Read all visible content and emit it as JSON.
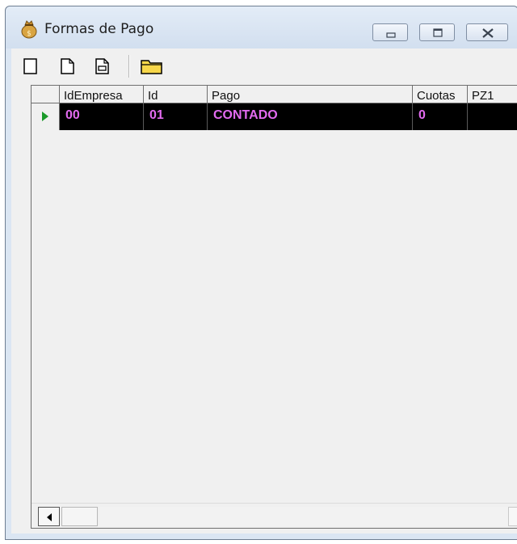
{
  "window": {
    "title": "Formas de Pago",
    "icon": "money-bag-icon"
  },
  "caption_buttons": {
    "minimize": "minimize-icon",
    "maximize": "maximize-icon",
    "close": "close-icon"
  },
  "toolbar": {
    "items": [
      "blank-page-icon",
      "new-document-icon",
      "edit-document-icon",
      "open-folder-icon"
    ]
  },
  "grid": {
    "columns": [
      "",
      "IdEmpresa",
      "Id",
      "Pago",
      "Cuotas",
      "PZ1"
    ],
    "rows": [
      {
        "IdEmpresa": "00",
        "Id": "01",
        "Pago": "CONTADO",
        "Cuotas": "0",
        "PZ1": ""
      }
    ],
    "selected_row_color": "#000000",
    "selected_text_color": "#e36bf0",
    "row_indicator": "current-row-arrow-icon"
  }
}
